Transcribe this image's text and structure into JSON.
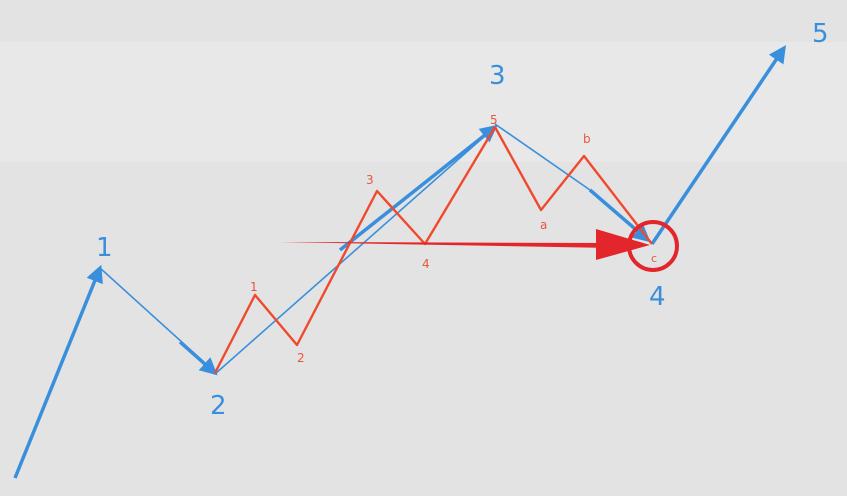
{
  "colors": {
    "background": "#e3e3e3",
    "major_wave": "#3a8fdc",
    "minor_wave": "#ef4a2e",
    "highlight": "#e3262b"
  },
  "major_labels": [
    "1",
    "2",
    "3",
    "4",
    "5"
  ],
  "minor_labels": [
    "1",
    "2",
    "3",
    "4",
    "5",
    "a",
    "b",
    "c"
  ]
}
